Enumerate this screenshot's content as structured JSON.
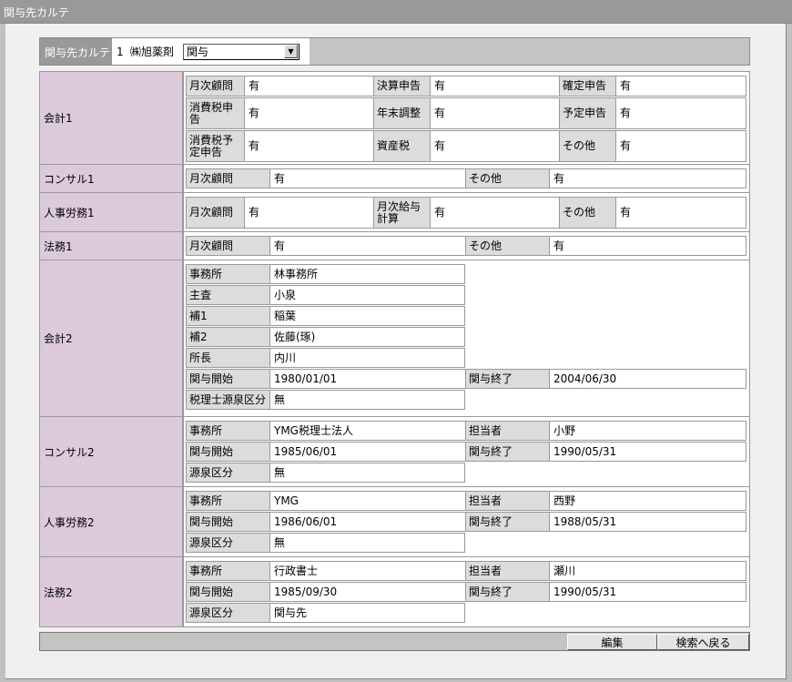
{
  "window": {
    "title": "関与先カルテ"
  },
  "header": {
    "label": "関与先カルテ",
    "number": "1",
    "client_name": "㈱旭薬剤",
    "select_value": "関与"
  },
  "sections": {
    "kaikei1": {
      "label": "会計1",
      "r1": {
        "l1": "月次顧問",
        "v1": "有",
        "l2": "決算申告",
        "v2": "有",
        "l3": "確定申告",
        "v3": "有"
      },
      "r2": {
        "l1": "消費税申告",
        "v1": "有",
        "l2": "年末調整",
        "v2": "有",
        "l3": "予定申告",
        "v3": "有"
      },
      "r3": {
        "l1": "消費税予定申告",
        "v1": "有",
        "l2": "資産税",
        "v2": "有",
        "l3": "その他",
        "v3": "有"
      }
    },
    "consul1": {
      "label": "コンサル1",
      "l1": "月次顧問",
      "v1": "有",
      "l2": "その他",
      "v2": "有"
    },
    "jinji1": {
      "label": "人事労務1",
      "l1": "月次顧問",
      "v1": "有",
      "l2": "月次給与計算",
      "v2": "有",
      "l3": "その他",
      "v3": "有"
    },
    "houmu1": {
      "label": "法務1",
      "l1": "月次顧問",
      "v1": "有",
      "l2": "その他",
      "v2": "有"
    },
    "kaikei2": {
      "label": "会計2",
      "office_l": "事務所",
      "office_v": "林事務所",
      "chief_l": "主査",
      "chief_v": "小泉",
      "asst1_l": "補1",
      "asst1_v": "稲葉",
      "asst2_l": "補2",
      "asst2_v": "佐藤(琢)",
      "head_l": "所長",
      "head_v": "内川",
      "start_l": "関与開始",
      "start_v": "1980/01/01",
      "end_l": "関与終了",
      "end_v": "2004/06/30",
      "src_l": "税理士源泉区分",
      "src_v": "無"
    },
    "consul2": {
      "label": "コンサル2",
      "office_l": "事務所",
      "office_v": "YMG税理士法人",
      "person_l": "担当者",
      "person_v": "小野",
      "start_l": "関与開始",
      "start_v": "1985/06/01",
      "end_l": "関与終了",
      "end_v": "1990/05/31",
      "src_l": "源泉区分",
      "src_v": "無"
    },
    "jinji2": {
      "label": "人事労務2",
      "office_l": "事務所",
      "office_v": "YMG",
      "person_l": "担当者",
      "person_v": "西野",
      "start_l": "関与開始",
      "start_v": "1986/06/01",
      "end_l": "関与終了",
      "end_v": "1988/05/31",
      "src_l": "源泉区分",
      "src_v": "無"
    },
    "houmu2": {
      "label": "法務2",
      "office_l": "事務所",
      "office_v": "行政書士",
      "person_l": "担当者",
      "person_v": "瀬川",
      "start_l": "関与開始",
      "start_v": "1985/09/30",
      "end_l": "関与終了",
      "end_v": "1990/05/31",
      "src_l": "源泉区分",
      "src_v": "関与先"
    }
  },
  "footer": {
    "edit_label": "編集",
    "back_label": "検索へ戻る"
  }
}
